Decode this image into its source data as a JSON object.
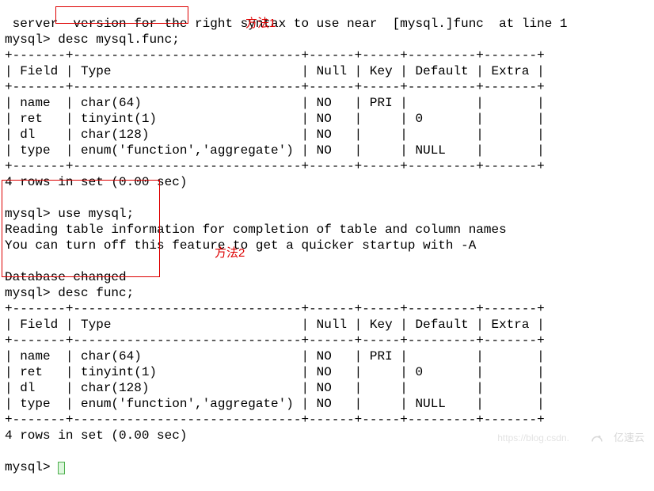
{
  "terminal": {
    "err_first": " server  version for the right syntax to use near  [mysql.]func  at line 1",
    "prompt": "mysql>",
    "cmd1": "desc mysql.func;",
    "sep": "+-------+------------------------------+------+-----+---------+-------+",
    "hdr": "| Field | Type                         | Null | Key | Default | Extra |",
    "rows": [
      "| name  | char(64)                     | NO   | PRI |         |       |",
      "| ret   | tinyint(1)                   | NO   |     | 0       |       |",
      "| dl    | char(128)                    | NO   |     |         |       |",
      "| type  | enum('function','aggregate') | NO   |     | NULL    |       |"
    ],
    "footer": "4 rows in set (0.00 sec)",
    "cmd2_use": "use mysql;",
    "read1": "Reading table information for completion of table and column names",
    "read2": "You can turn off this feature to get a quicker startup with -A",
    "dbchanged": "Database changed",
    "cmd2_desc": "desc func;"
  },
  "labels": {
    "method1": "方法1",
    "method2": "方法2"
  },
  "watermark": {
    "url": "https://blog.csdn.",
    "brand": "亿速云"
  }
}
